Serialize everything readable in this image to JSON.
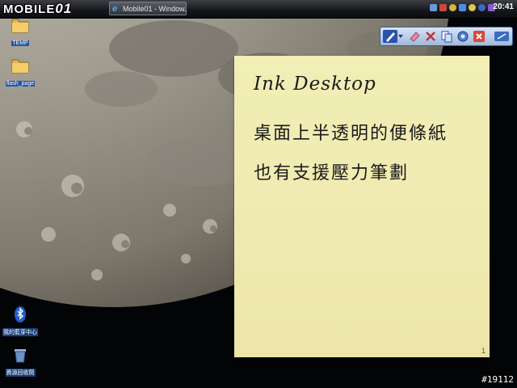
{
  "watermark": {
    "brand": "MOBILE",
    "number": "01",
    "post_id": "#19112"
  },
  "taskbar": {
    "task_button_label": "Mobile01 - Window...",
    "clock": "20:41",
    "colors": {
      "bar": "#1a1c20",
      "task_button": "#3a3d45"
    }
  },
  "desktop_icons": [
    {
      "name": "temp-folder",
      "label": "TEMP",
      "icon": "folder-icon"
    },
    {
      "name": "flash-page-folder",
      "label": "flash_page",
      "icon": "folder-icon"
    },
    {
      "name": "bluetooth",
      "label": "我的藍芽中心",
      "icon": "bluetooth-icon"
    },
    {
      "name": "recycle-bin",
      "label": "資源回收筒",
      "icon": "recycle-bin-icon"
    }
  ],
  "ink_toolbar": {
    "buttons": [
      "pen-icon",
      "dropdown-arrow-icon",
      "eraser-icon",
      "delete-icon",
      "copy-icon",
      "settings-icon",
      "close-icon",
      "minimize-icon"
    ],
    "accent": "#2a52a8"
  },
  "sticky_note": {
    "line1": "Ink Desktop",
    "line2": "桌面上半透明的便條紙",
    "line3": "也有支援壓力筆劃",
    "page_number": "1",
    "background": "#efeab0"
  }
}
